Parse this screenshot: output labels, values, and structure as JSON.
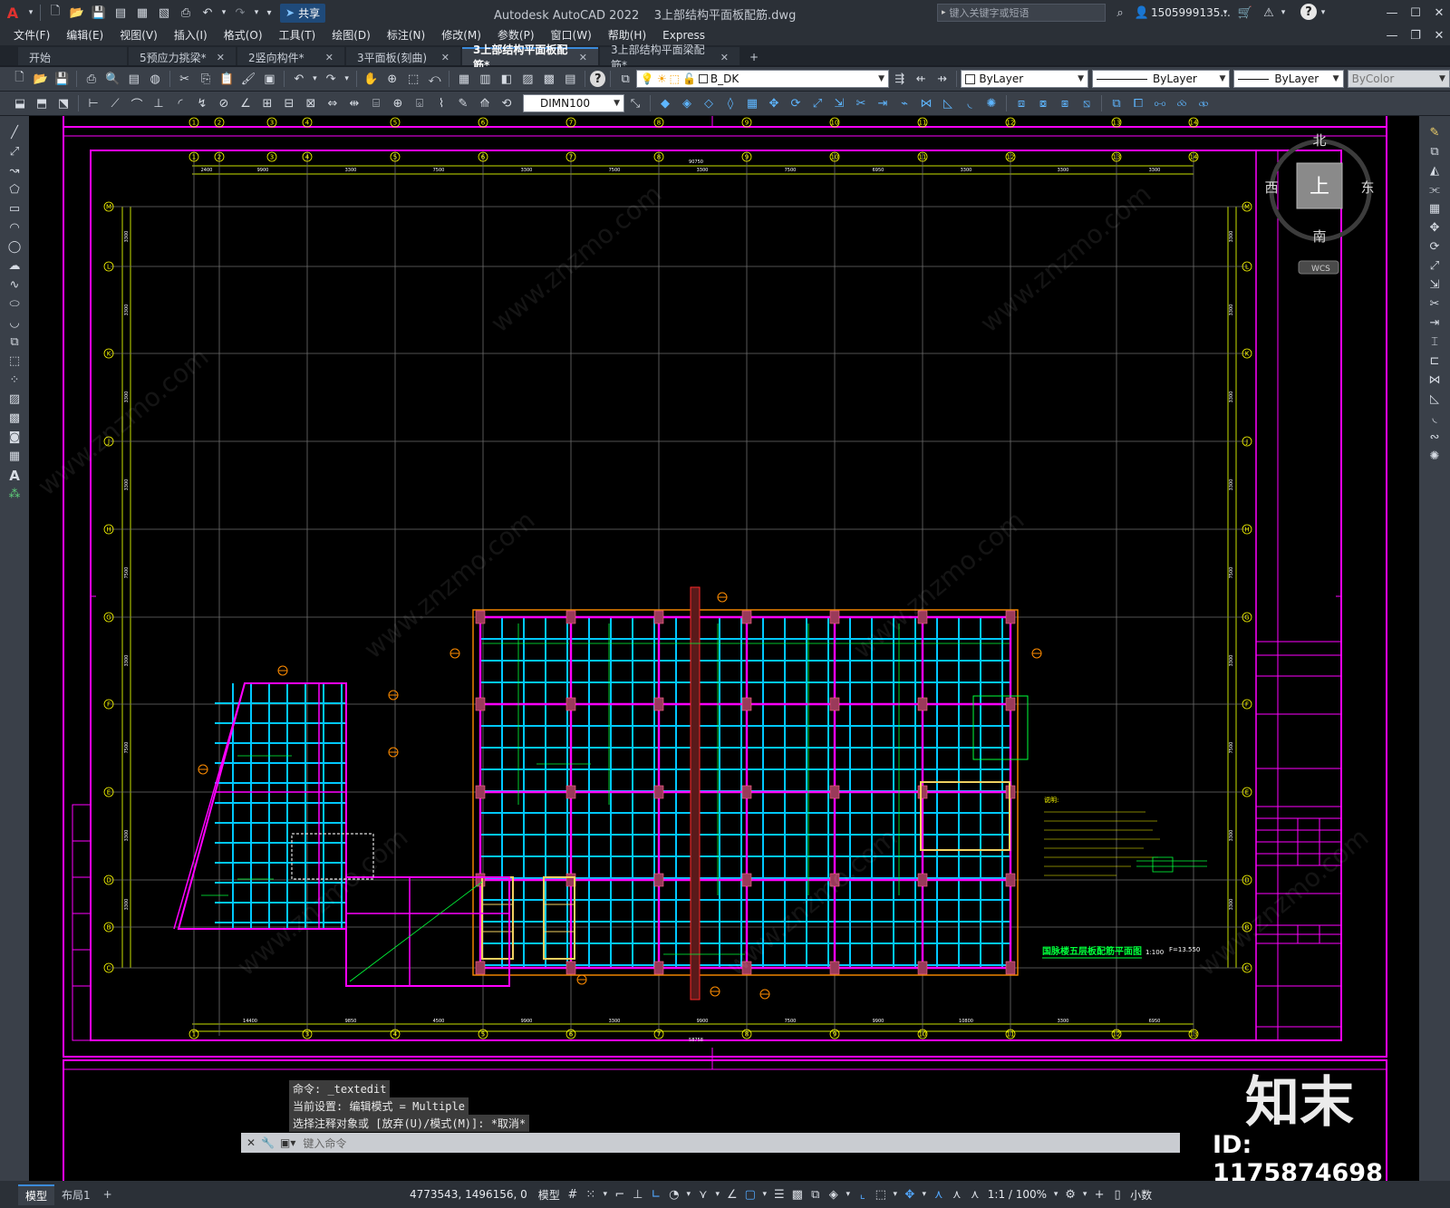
{
  "app": {
    "title": "Autodesk AutoCAD 2022    3上部结构平面板配筋.dwg",
    "share_label": "共享",
    "search_placeholder": "键入关键字或短语",
    "user": "1505999135...",
    "logo": "A"
  },
  "menu": [
    "文件(F)",
    "编辑(E)",
    "视图(V)",
    "插入(I)",
    "格式(O)",
    "工具(T)",
    "绘图(D)",
    "标注(N)",
    "修改(M)",
    "参数(P)",
    "窗口(W)",
    "帮助(H)",
    "Express"
  ],
  "tabs": [
    {
      "label": "开始",
      "active": false,
      "closable": false
    },
    {
      "label": "5预应力挑梁*",
      "active": false,
      "closable": true
    },
    {
      "label": "2竖向构件*",
      "active": false,
      "closable": true
    },
    {
      "label": "3平面板(刻曲)",
      "active": false,
      "closable": true
    },
    {
      "label": "3上部结构平面板配筋*",
      "active": true,
      "closable": true
    },
    {
      "label": "3上部结构平面梁配筋*",
      "active": false,
      "closable": true
    }
  ],
  "properties": {
    "layer": "B_DK",
    "color": "ByLayer",
    "linetype": "ByLayer",
    "lineweight": "ByLayer",
    "plotstyle": "ByColor",
    "dimstyle": "DIMN100"
  },
  "viewcube": {
    "north": "北",
    "south": "南",
    "east": "东",
    "west": "西",
    "top": "上",
    "wcs": "WCS"
  },
  "drawing": {
    "plan_title": "国脉楼五层板配筋平面图",
    "scale": "1:100",
    "elevation": "F=13.550",
    "notes_title": "说明:",
    "grid_top": [
      "1",
      "2",
      "3",
      "4",
      "5",
      "6",
      "7",
      "8",
      "9",
      "10",
      "11",
      "12",
      "13",
      "14"
    ],
    "grid_bottom": [
      "1",
      "3",
      "4",
      "5",
      "6",
      "7",
      "8",
      "9",
      "10",
      "11",
      "12",
      "13",
      "14"
    ],
    "grid_left": [
      "M",
      "L",
      "K",
      "J",
      "H",
      "G",
      "F",
      "E",
      "D",
      "B",
      "C"
    ],
    "top_dims": [
      "2400",
      "9900",
      "3300",
      "7500",
      "3300",
      "7500",
      "3300",
      "7500",
      "6950",
      "3300",
      "3300",
      "3300"
    ],
    "bottom_dims": [
      "14400",
      "9850",
      "4500",
      "9900",
      "3300",
      "9900",
      "7500",
      "9900",
      "10800",
      "3300",
      "6950"
    ],
    "overall_dim": "90750",
    "bottom_overall_dim": "58758",
    "left_dims": [
      "3300",
      "3300",
      "3300",
      "3300",
      "7500",
      "3300",
      "7500",
      "3300",
      "3300"
    ]
  },
  "command": {
    "history": [
      "命令: _textedit",
      "当前设置: 编辑模式 = Multiple",
      "选择注释对象或 [放弃(U)/模式(M)]: *取消*"
    ],
    "prompt_placeholder": "键入命令"
  },
  "layout_tabs": [
    "模型",
    "布局1"
  ],
  "status": {
    "coords": "4773543, 1496156, 0",
    "model_label": "模型",
    "annotation_scale": "1:1 / 100%",
    "units": "小数"
  },
  "watermark": {
    "brand": "知末",
    "id": "ID: 1175874698",
    "site": "www.znzmo.com"
  },
  "colors": {
    "accent": "#3b8ad9",
    "magenta": "#ff00ff",
    "cyan": "#00d8ff",
    "yellow": "#ffff00",
    "orange": "#ff8c00",
    "green": "#00ff3a",
    "red": "#ff2020"
  }
}
